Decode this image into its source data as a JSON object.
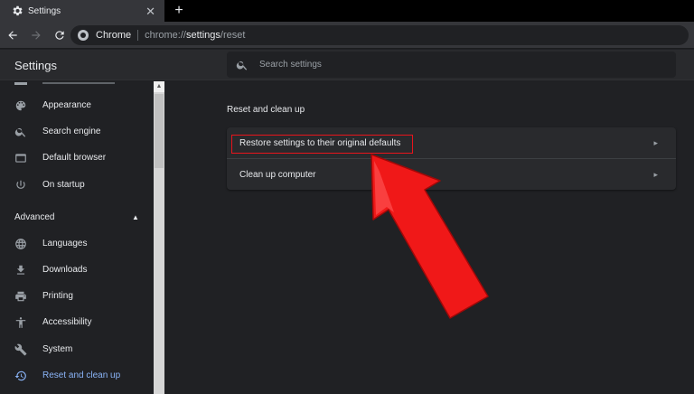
{
  "browser": {
    "tab": {
      "title": "Settings",
      "icon": "gear-icon"
    },
    "new_tab_label": "+",
    "close_label": "✕",
    "omnibox": {
      "site_name": "Chrome",
      "url_scheme": "chrome://",
      "url_host": "settings",
      "url_path": "/reset"
    }
  },
  "header": {
    "title": "Settings",
    "search_placeholder": "Search settings"
  },
  "sidebar": {
    "items": [
      {
        "label": "Appearance",
        "icon": "palette-icon"
      },
      {
        "label": "Search engine",
        "icon": "search-icon"
      },
      {
        "label": "Default browser",
        "icon": "browser-window-icon"
      },
      {
        "label": "On startup",
        "icon": "power-icon"
      }
    ],
    "advanced_label": "Advanced",
    "advanced_items": [
      {
        "label": "Languages",
        "icon": "globe-icon"
      },
      {
        "label": "Downloads",
        "icon": "download-icon"
      },
      {
        "label": "Printing",
        "icon": "printer-icon"
      },
      {
        "label": "Accessibility",
        "icon": "accessibility-icon"
      },
      {
        "label": "System",
        "icon": "wrench-icon"
      },
      {
        "label": "Reset and clean up",
        "icon": "history-icon",
        "active": true
      }
    ]
  },
  "main": {
    "section_title": "Reset and clean up",
    "rows": [
      {
        "label": "Restore settings to their original defaults",
        "highlighted": true
      },
      {
        "label": "Clean up computer"
      }
    ]
  },
  "colors": {
    "accent": "#8ab4f8",
    "annotation_red": "#e8141c"
  }
}
